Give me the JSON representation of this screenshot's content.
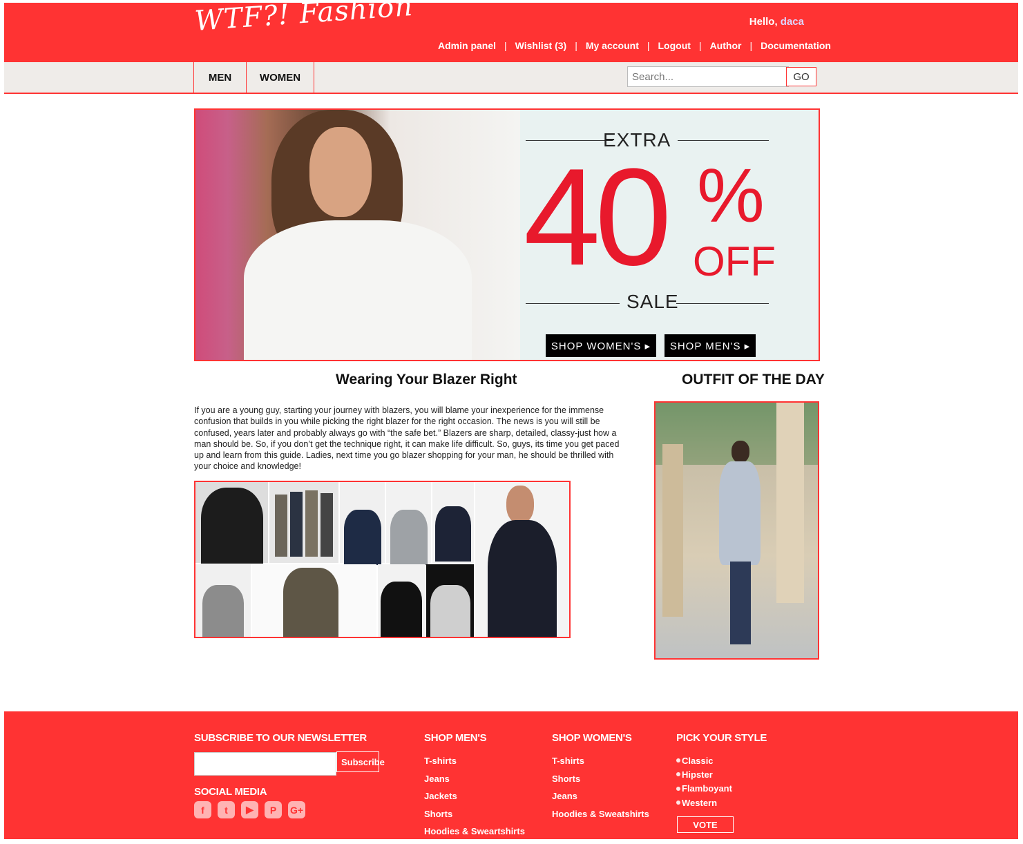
{
  "header": {
    "logo": "WTF?! Fashion",
    "greeting": "Hello,",
    "username": "daca",
    "links": [
      "Admin panel",
      "Wishlist (3)",
      "My account",
      "Logout",
      "Author",
      "Documentation"
    ]
  },
  "nav": {
    "categories": [
      "MEN",
      "WOMEN"
    ],
    "search_placeholder": "Search...",
    "search_button": "GO"
  },
  "banner": {
    "extra": "EXTRA",
    "percent": "40",
    "percent_sign": "%",
    "off": "OFF",
    "sale": "SALE",
    "shop_women": "SHOP WOMEN'S ▸",
    "shop_men": "SHOP MEN'S ▸"
  },
  "article": {
    "title": "Wearing Your Blazer Right",
    "body": "If you are a young guy, starting your journey with blazers, you will blame your inexperience for the immense confusion that builds in you while picking the right blazer for the right occasion. The news is you will still be confused, years later and probably always go with “the safe bet.” Blazers are sharp, detailed, classy-just how a man should be. So, if you don’t get the technique right, it can make life difficult. So, guys, its time you get paced up and learn from this guide. Ladies, next time you go blazer shopping for your man, he should be thrilled with your choice and knowledge!"
  },
  "outfit": {
    "title": "OUTFIT OF THE DAY"
  },
  "footer": {
    "newsletter_title": "SUBSCRIBE TO OUR NEWSLETTER",
    "subscribe_button": "Subscribe",
    "social_title": "SOCIAL MEDIA",
    "social_icons": [
      "facebook-icon",
      "twitter-icon",
      "youtube-icon",
      "pinterest-icon",
      "google-plus-icon"
    ],
    "men_title": "SHOP MEN'S",
    "men_links": [
      "T-shirts",
      "Jeans",
      "Jackets",
      "Shorts",
      "Hoodies & Sweartshirts"
    ],
    "women_title": "SHOP WOMEN'S",
    "women_links": [
      "T-shirts",
      "Shorts",
      "Jeans",
      "Hoodies & Sweatshirts"
    ],
    "style_title": "PICK YOUR STYLE",
    "style_options": [
      "Classic",
      "Hipster",
      "Flamboyant",
      "Western"
    ],
    "vote_button": "VOTE"
  },
  "colors": {
    "brand_red": "#ff3333",
    "nav_bg": "#efece9",
    "banner_red": "#e8192c"
  }
}
